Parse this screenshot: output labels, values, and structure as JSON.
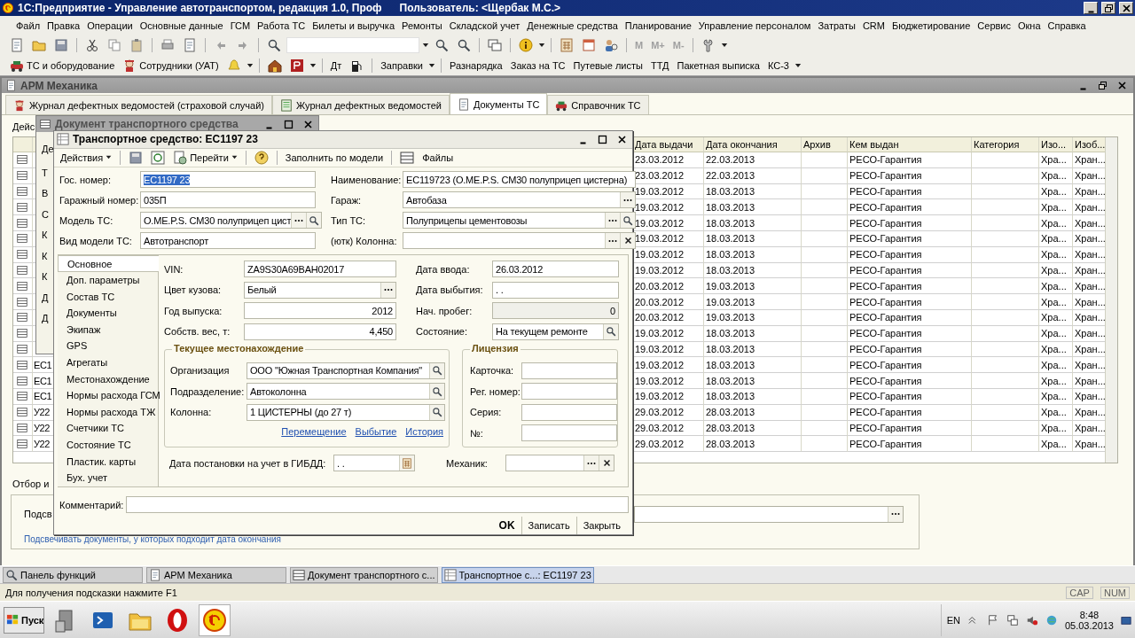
{
  "window": {
    "title": "1С:Предприятие - Управление автотранспортом, редакция 1.0, Проф",
    "user": "Пользователь: <Щербак М.С.>"
  },
  "menu": [
    "Файл",
    "Правка",
    "Операции",
    "Основные данные",
    "ГСМ",
    "Работа ТС",
    "Билеты и выручка",
    "Ремонты",
    "Складской учет",
    "Денежные средства",
    "Планирование",
    "Управление персоналом",
    "Затраты",
    "CRM",
    "Бюджетирование",
    "Сервис",
    "Окна",
    "Справка"
  ],
  "memory_buttons": [
    {
      "label": "M",
      "disabled": true
    },
    {
      "label": "M+",
      "disabled": true
    },
    {
      "label": "M-",
      "disabled": true
    }
  ],
  "quick_bar": [
    "ТС и оборудование",
    "Сотрудники (УАТ)",
    "Дт",
    "Заправки",
    "Разнарядка",
    "Заказ на ТС",
    "Путевые листы",
    "ТТД",
    "Пакетная выписка",
    "КС-3"
  ],
  "arm_window": {
    "title": "АРМ Механика",
    "tabs": [
      {
        "label": "Журнал дефектных ведомостей (страховой случай)",
        "selected": false
      },
      {
        "label": "Журнал дефектных ведомостей",
        "selected": false
      },
      {
        "label": "Документы ТС",
        "selected": true
      },
      {
        "label": "Справочник ТС",
        "selected": false
      }
    ],
    "actions_fragment": "Дейс",
    "table": {
      "columns": [
        "Дата выдачи",
        "Дата окончания",
        "Архив",
        "Кем выдан",
        "Категория",
        "Изо...",
        "Изоб..."
      ],
      "rows": [
        {
          "date_issued": "23.03.2012",
          "date_end": "22.03.2013",
          "issued_by": "РЕСО-Гарантия",
          "column_7": "Хра...",
          "column_8": "Хран..."
        },
        {
          "date_issued": "23.03.2012",
          "date_end": "22.03.2013",
          "issued_by": "РЕСО-Гарантия",
          "column_7": "Хра...",
          "column_8": "Хран..."
        },
        {
          "date_issued": "19.03.2012",
          "date_end": "18.03.2013",
          "issued_by": "РЕСО-Гарантия",
          "column_7": "Хра...",
          "column_8": "Хран..."
        },
        {
          "date_issued": "19.03.2012",
          "date_end": "18.03.2013",
          "issued_by": "РЕСО-Гарантия",
          "column_7": "Хра...",
          "column_8": "Хран..."
        },
        {
          "date_issued": "19.03.2012",
          "date_end": "18.03.2013",
          "issued_by": "РЕСО-Гарантия",
          "column_7": "Хра...",
          "column_8": "Хран..."
        },
        {
          "date_issued": "19.03.2012",
          "date_end": "18.03.2013",
          "issued_by": "РЕСО-Гарантия",
          "column_7": "Хра...",
          "column_8": "Хран..."
        },
        {
          "date_issued": "19.03.2012",
          "date_end": "18.03.2013",
          "issued_by": "РЕСО-Гарантия",
          "column_7": "Хра...",
          "column_8": "Хран..."
        },
        {
          "date_issued": "19.03.2012",
          "date_end": "18.03.2013",
          "issued_by": "РЕСО-Гарантия",
          "column_7": "Хра...",
          "column_8": "Хран..."
        },
        {
          "date_issued": "20.03.2012",
          "date_end": "19.03.2013",
          "issued_by": "РЕСО-Гарантия",
          "column_7": "Хра...",
          "column_8": "Хран..."
        },
        {
          "date_issued": "20.03.2012",
          "date_end": "19.03.2013",
          "issued_by": "РЕСО-Гарантия",
          "column_7": "Хра...",
          "column_8": "Хран..."
        },
        {
          "date_issued": "20.03.2012",
          "date_end": "19.03.2013",
          "issued_by": "РЕСО-Гарантия",
          "column_7": "Хра...",
          "column_8": "Хран..."
        },
        {
          "date_issued": "19.03.2012",
          "date_end": "18.03.2013",
          "issued_by": "РЕСО-Гарантия",
          "column_7": "Хра...",
          "column_8": "Хран..."
        },
        {
          "date_issued": "19.03.2012",
          "date_end": "18.03.2013",
          "issued_by": "РЕСО-Гарантия",
          "column_7": "Хра...",
          "column_8": "Хран..."
        },
        {
          "column_2": "ЕС1",
          "date_issued": "19.03.2012",
          "date_end": "18.03.2013",
          "issued_by": "РЕСО-Гарантия",
          "column_7": "Хра...",
          "column_8": "Хран..."
        },
        {
          "column_2": "ЕС1",
          "date_issued": "19.03.2012",
          "date_end": "18.03.2013",
          "issued_by": "РЕСО-Гарантия",
          "column_7": "Хра...",
          "column_8": "Хран..."
        },
        {
          "column_2": "ЕС1",
          "date_issued": "19.03.2012",
          "date_end": "18.03.2013",
          "issued_by": "РЕСО-Гарантия",
          "column_7": "Хра...",
          "column_8": "Хран..."
        },
        {
          "column_2": "У22",
          "date_issued": "29.03.2012",
          "date_end": "28.03.2013",
          "issued_by": "РЕСО-Гарантия",
          "column_7": "Хра...",
          "column_8": "Хран..."
        },
        {
          "column_2": "У22",
          "date_issued": "29.03.2012",
          "date_end": "28.03.2013",
          "issued_by": "РЕСО-Гарантия",
          "column_7": "Хра...",
          "column_8": "Хран..."
        },
        {
          "column_2": "У22",
          "date_issued": "29.03.2012",
          "date_end": "28.03.2013",
          "issued_by": "РЕСО-Гарантия",
          "column_7": "Хра...",
          "column_8": "Хран..."
        }
      ]
    },
    "filter_label": "Отбор и",
    "highlight_label": "Подсв",
    "highlight_note": "Подсвечивать документы, у которых подходит дата окончания"
  },
  "document_window": {
    "title": "Документ транспортного средства",
    "fragments": [
      "Де",
      "Т",
      "В",
      "С",
      "К",
      "К",
      "К",
      "Д",
      "Д"
    ]
  },
  "vehicle_window": {
    "title": "Транспортное средство: ЕС1197 23",
    "toolbar": [
      "Действия",
      "Перейти",
      "Заполнить по модели",
      "Файлы"
    ],
    "fields_left": [
      {
        "label": "Гос. номер:",
        "value": "ЕС1197 23",
        "kind": "plain",
        "text_selected": true
      },
      {
        "label": "Гаражный номер:",
        "value": "035П",
        "kind": "plain",
        "text_selected": false
      },
      {
        "label": "Модель ТС:",
        "value": "O.ME.P.S. CM30 полуприцеп цист",
        "kind": "select_search",
        "text_selected": false
      },
      {
        "label": "Вид модели ТС:",
        "value": "Автотранспорт",
        "kind": "plain",
        "text_selected": false
      }
    ],
    "fields_right": [
      {
        "label": "Наименование:",
        "value": "ЕС119723 (O.ME.P.S. CM30 полуприцеп цистерна)",
        "kind": "plain"
      },
      {
        "label": "Гараж:",
        "value": "Автобаза",
        "kind": "select"
      },
      {
        "label": "Тип ТС:",
        "value": "Полуприцепы цементовозы",
        "kind": "select_search"
      },
      {
        "label": "(ютк) Колонна:",
        "kind": "select_clear"
      }
    ],
    "tabs": [
      {
        "label": "Основное",
        "selected": true
      },
      {
        "label": "Доп. параметры",
        "selected": false
      },
      {
        "label": "Состав ТС",
        "selected": false
      },
      {
        "label": "Документы",
        "selected": false
      },
      {
        "label": "Экипаж",
        "selected": false
      },
      {
        "label": "GPS",
        "selected": false
      },
      {
        "label": "Агрегаты",
        "selected": false
      },
      {
        "label": "Местонахождение",
        "selected": false
      },
      {
        "label": "Нормы расхода ГСМ",
        "selected": false
      },
      {
        "label": "Нормы расхода ТЖ",
        "selected": false
      },
      {
        "label": "Счетчики ТС",
        "selected": false
      },
      {
        "label": "Состояние ТС",
        "selected": false
      },
      {
        "label": "Пластик. карты",
        "selected": false
      },
      {
        "label": "Бух. учет",
        "selected": false
      }
    ],
    "main_left": [
      {
        "label": "VIN:",
        "value": "ZA9S30A69BAH02017",
        "kind": "plain"
      },
      {
        "label": "Цвет кузова:",
        "value": "Белый",
        "kind": "select"
      },
      {
        "label": "Год выпуска:",
        "value": "2012",
        "kind": "number"
      },
      {
        "label": "Собств. вес, т:",
        "value": "4,450",
        "kind": "number"
      }
    ],
    "main_right": [
      {
        "label": "Дата ввода:",
        "value": "26.03.2012",
        "kind": "plain"
      },
      {
        "label": "Дата выбытия:",
        "value": ". .",
        "kind": "plain"
      },
      {
        "label": "Нач. пробег:",
        "value": "0",
        "kind": "readonly_number"
      },
      {
        "label": "Состояние:",
        "value": "На текущем ремонте",
        "kind": "search"
      }
    ],
    "location": {
      "title": "Текущее местонахождение",
      "fields": [
        {
          "label": "Организация",
          "value": "ООО \"Южная Транспортная Компания\"",
          "kind": "search"
        },
        {
          "label": "Подразделение:",
          "value": "Автоколонна",
          "kind": "search"
        },
        {
          "label": "Колонна:",
          "value": "1 ЦИСТЕРНЫ (до 27 т)",
          "kind": "search"
        }
      ],
      "links": [
        "Перемещение",
        "Выбытие",
        "История"
      ]
    },
    "license": {
      "title": "Лицензия",
      "fields": [
        {
          "label": "Карточка:"
        },
        {
          "label": "Рег. номер:"
        },
        {
          "label": "Серия:"
        },
        {
          "label": "№:"
        }
      ]
    },
    "registration": {
      "label": "Дата постановки на учет в ГИБДД:",
      "value": ". .",
      "kind": "date"
    },
    "mechanic": {
      "label": "Механик:",
      "kind": "select_clear"
    },
    "comment": {
      "label": "Комментарий:"
    },
    "buttons": [
      {
        "label": "OK",
        "default": true
      },
      {
        "label": "Записать",
        "default": false
      },
      {
        "label": "Закрыть",
        "default": false
      }
    ]
  },
  "window_list": [
    {
      "label": "Панель функций",
      "selected": false
    },
    {
      "label": "АРМ Механика",
      "selected": false
    },
    {
      "label": "Документ транспортного с...",
      "selected": false
    },
    {
      "label": "Транспортное с...: ЕС1197 23",
      "selected": true
    }
  ],
  "status_bar": {
    "hint": "Для получения подсказки нажмите F1",
    "indicators": [
      "CAP",
      "NUM"
    ]
  },
  "taskbar": {
    "start": "Пуск",
    "language": "EN",
    "time": "8:48",
    "date": "05.03.2013"
  }
}
